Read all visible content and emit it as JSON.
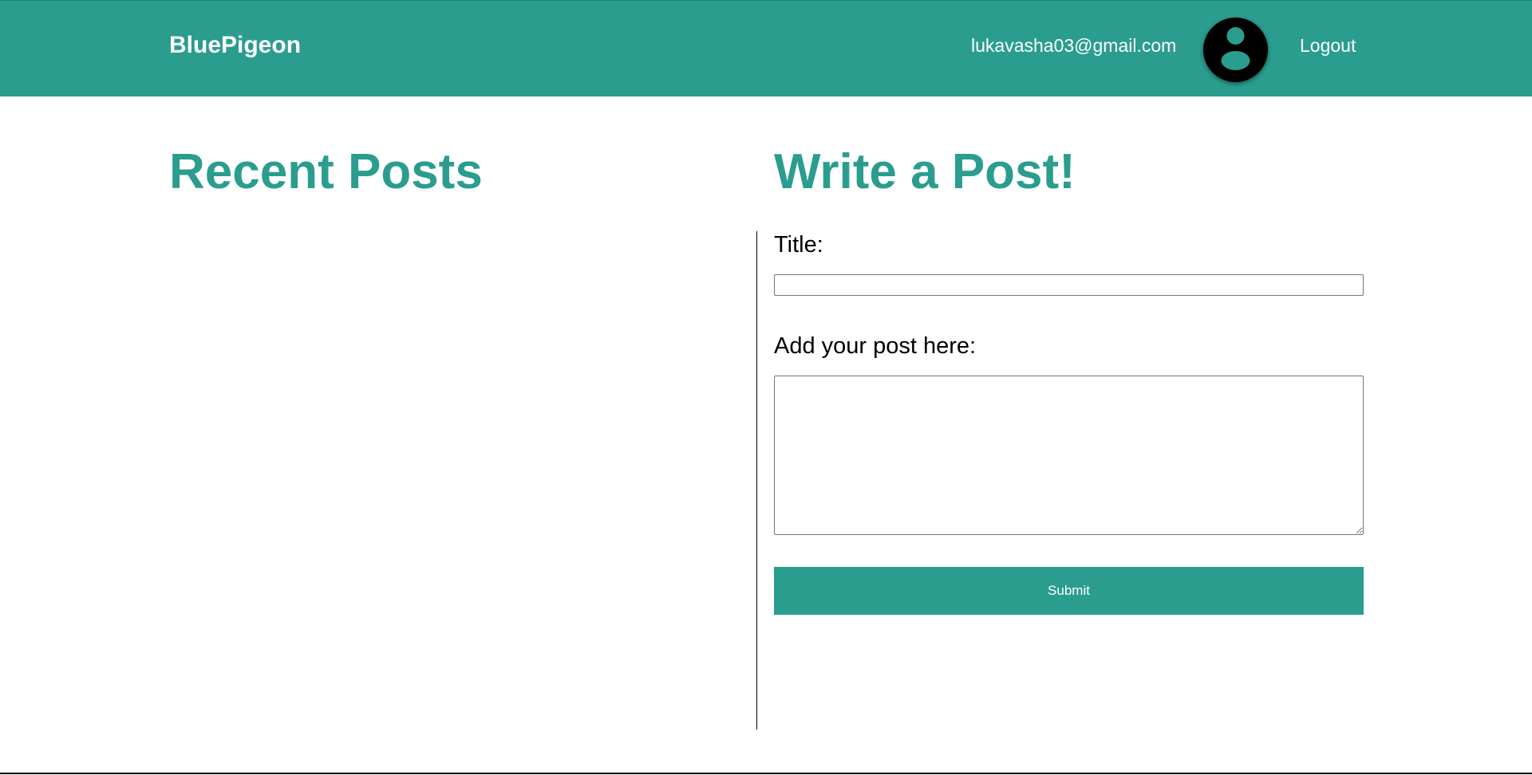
{
  "header": {
    "brand": "BluePigeon",
    "user_email": "lukavasha03@gmail.com",
    "avatar_icon": "user-avatar-icon",
    "logout_label": "Logout",
    "background_color": "#2a9d8f"
  },
  "recent_posts": {
    "heading": "Recent Posts",
    "items": []
  },
  "write_post": {
    "heading": "Write a Post!",
    "title_label": "Title:",
    "title_value": "",
    "body_label": "Add your post here:",
    "body_value": "",
    "submit_label": "Submit"
  },
  "colors": {
    "accent": "#2a9d8f",
    "text": "#000000",
    "background": "#ffffff"
  }
}
